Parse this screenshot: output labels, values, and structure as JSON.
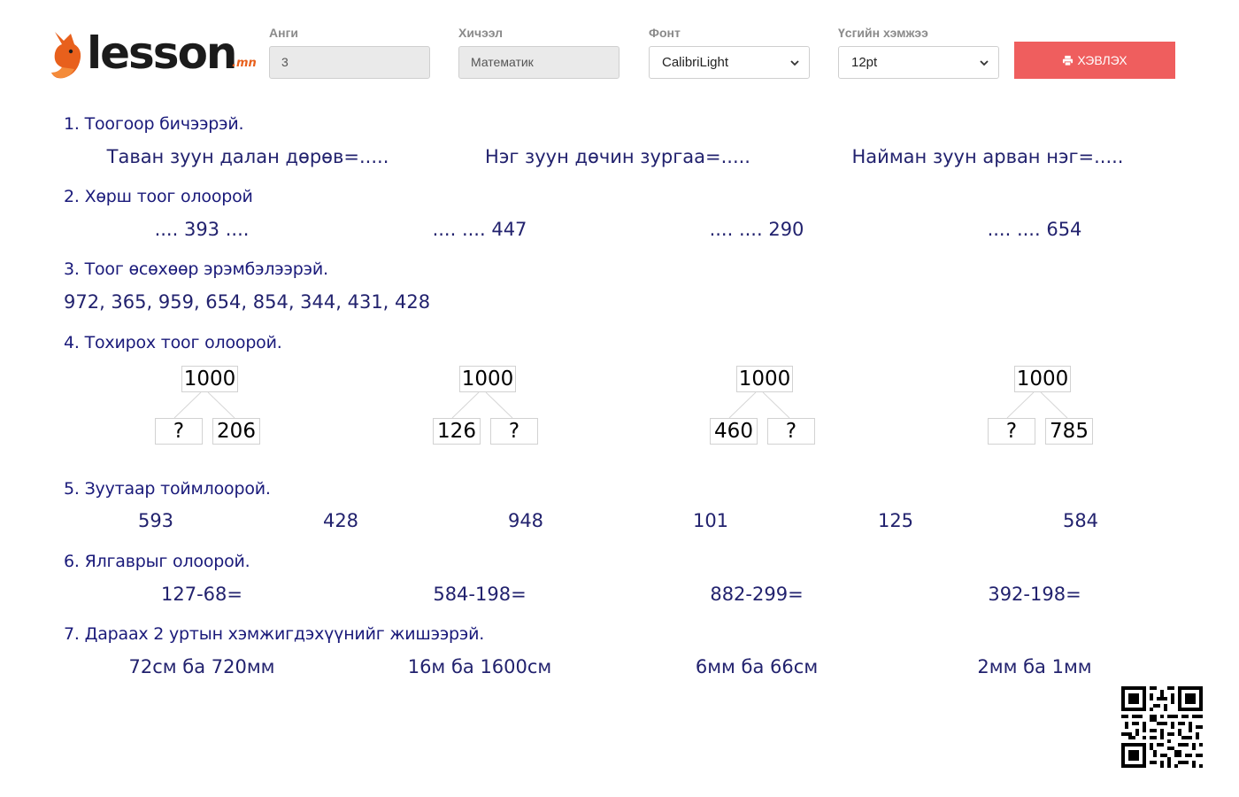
{
  "header": {
    "logo": {
      "word": "lesson",
      "tld": ".mn"
    },
    "grade": {
      "label": "Анги",
      "value": "3"
    },
    "subject": {
      "label": "Хичээл",
      "value": "Математик"
    },
    "font": {
      "label": "Фонт",
      "selected": "CalibriLight"
    },
    "font_size": {
      "label": "Үсгийн хэмжээ",
      "selected": "12pt"
    },
    "print_label": "ХЭВЛЭХ"
  },
  "colors": {
    "accent": "#ef5e5e",
    "heading": "#1a1a7a",
    "text": "#22226e",
    "logo_orange": "#e8601c"
  },
  "icons": {
    "print": "printer-icon",
    "select": "chevron-down-icon",
    "logo": "fox-icon",
    "qr": "qr-code-icon"
  },
  "questions": {
    "q1": {
      "title": "1. Тоогоор бичээрэй.",
      "items": [
        "Таван зуун далан дөрөв=.....",
        "Нэг зуун дөчин зургаа=.....",
        "Найман зуун арван нэг=....."
      ]
    },
    "q2": {
      "title": "2. Хөрш тоог олоорой",
      "items": [
        ".... 393 ....",
        ".... .... 447",
        ".... .... 290",
        ".... .... 654"
      ]
    },
    "q3": {
      "title": "3. Тоог өсөхөөр эрэмбэлээрэй.",
      "sequence": "972, 365, 959, 654, 854, 344, 431, 428"
    },
    "q4": {
      "title": "4. Тохирох тоог олоорой.",
      "bonds": [
        {
          "whole": "1000",
          "left": "?",
          "right": "206"
        },
        {
          "whole": "1000",
          "left": "126",
          "right": "?"
        },
        {
          "whole": "1000",
          "left": "460",
          "right": "?"
        },
        {
          "whole": "1000",
          "left": "?",
          "right": "785"
        }
      ]
    },
    "q5": {
      "title": "5. Зуутаар тоймлоорой.",
      "items": [
        "593",
        "428",
        "948",
        "101",
        "125",
        "584"
      ]
    },
    "q6": {
      "title": "6. Ялгаврыг олоорой.",
      "items": [
        "127-68=",
        "584-198=",
        "882-299=",
        "392-198="
      ]
    },
    "q7": {
      "title": "7. Дараах 2 уртын хэмжигдэхүүнийг жишээрэй.",
      "items": [
        "72см ба 720мм",
        "16м ба 1600см",
        "6мм ба 66см",
        "2мм ба 1мм"
      ]
    }
  }
}
